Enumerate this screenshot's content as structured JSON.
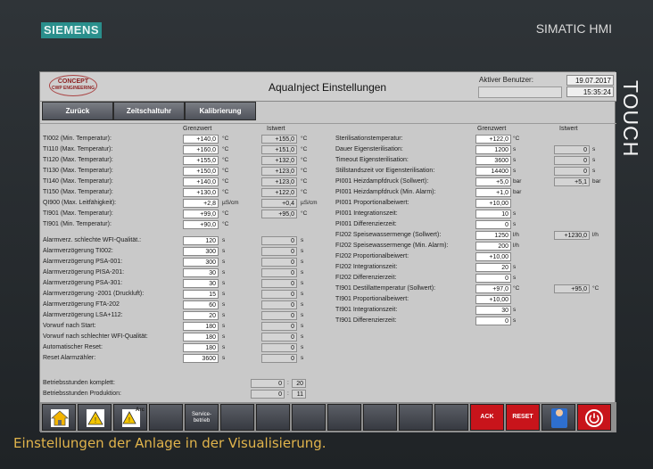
{
  "device": {
    "brand": "SIEMENS",
    "product": "SIMATIC HMI",
    "side_label": "TOUCH"
  },
  "header": {
    "logo_top": "CONCEPT",
    "logo_sub": "CWP ENGINEERING",
    "title": "AquaInject Einstellungen",
    "user_label": "Aktiver Benutzer:",
    "date": "19.07.2017",
    "time": "15:35:24"
  },
  "nav": {
    "back": "Zurück",
    "timer": "Zeitschaltuhr",
    "calibration": "Kalibrierung"
  },
  "columns": {
    "left_set": "Grenzwert",
    "left_actual": "Istwert",
    "right_set": "Grenzwert",
    "right_actual": "Istwert"
  },
  "left_limits": [
    {
      "label": "TI002 (Min. Temperatur):",
      "set": "+140,0",
      "unit": "°C",
      "actual": "+155,0",
      "aunit": "°C"
    },
    {
      "label": "TI110 (Max. Temperatur):",
      "set": "+160,0",
      "unit": "°C",
      "actual": "+151,0",
      "aunit": "°C"
    },
    {
      "label": "TI120 (Max. Temperatur):",
      "set": "+155,0",
      "unit": "°C",
      "actual": "+132,0",
      "aunit": "°C"
    },
    {
      "label": "TI130 (Max. Temperatur):",
      "set": "+150,0",
      "unit": "°C",
      "actual": "+123,0",
      "aunit": "°C"
    },
    {
      "label": "TI140 (Max. Temperatur):",
      "set": "+140,0",
      "unit": "°C",
      "actual": "+123,0",
      "aunit": "°C"
    },
    {
      "label": "TI150 (Max. Temperatur):",
      "set": "+130,0",
      "unit": "°C",
      "actual": "+122,0",
      "aunit": "°C"
    },
    {
      "label": "QI900 (Max. Leitfähigkeit):",
      "set": "+2,8",
      "unit": "µS/cm",
      "actual": "+0,4",
      "aunit": "µS/cm"
    },
    {
      "label": "TI901 (Max. Temperatur):",
      "set": "+99,0",
      "unit": "°C",
      "actual": "+95,0",
      "aunit": "°C"
    },
    {
      "label": "TI901 (Min. Temperatur):",
      "set": "+90,0",
      "unit": "°C",
      "actual": "",
      "aunit": ""
    }
  ],
  "left_delays": [
    {
      "label": "Alarmverz. schlechte WFI-Qualität.:",
      "set": "120",
      "unit": "s",
      "actual": "0",
      "aunit": "s"
    },
    {
      "label": "Alarmverzögerung TI002:",
      "set": "300",
      "unit": "s",
      "actual": "0",
      "aunit": "s"
    },
    {
      "label": "Alarmverzögerung PSA-001:",
      "set": "300",
      "unit": "s",
      "actual": "0",
      "aunit": "s"
    },
    {
      "label": "Alarmverzögerung PISA-201:",
      "set": "30",
      "unit": "s",
      "actual": "0",
      "aunit": "s"
    },
    {
      "label": "Alarmverzögerung PSA-301:",
      "set": "30",
      "unit": "s",
      "actual": "0",
      "aunit": "s"
    },
    {
      "label": "Alarmverzögerung -2001 (Druckluft):",
      "set": "15",
      "unit": "s",
      "actual": "0",
      "aunit": "s"
    },
    {
      "label": "Alarmverzögerung FTA-202",
      "set": "60",
      "unit": "s",
      "actual": "0",
      "aunit": "s"
    },
    {
      "label": "Alarmverzögerung LSA+112:",
      "set": "20",
      "unit": "s",
      "actual": "0",
      "aunit": "s"
    },
    {
      "label": "Vorwurf nach Start:",
      "set": "180",
      "unit": "s",
      "actual": "0",
      "aunit": "s"
    },
    {
      "label": "Vorwurf nach schlechter WFI-Qualität:",
      "set": "180",
      "unit": "s",
      "actual": "0",
      "aunit": "s"
    },
    {
      "label": "Automatischer Reset:",
      "set": "180",
      "unit": "s",
      "actual": "0",
      "aunit": "s"
    },
    {
      "label": "Reset Alarmzähler:",
      "set": "3600",
      "unit": "s",
      "actual": "0",
      "aunit": "s"
    }
  ],
  "hours": [
    {
      "label": "Betriebsstunden komplett:",
      "h": "0",
      "m": "20"
    },
    {
      "label": "Betriebsstunden Produktion:",
      "h": "0",
      "m": "11"
    }
  ],
  "right_rows": [
    {
      "label": "Sterilisationstemperatur:",
      "set": "+122,0",
      "unit": "°C",
      "actual": "",
      "aunit": ""
    },
    {
      "label": "Dauer Eigensterilisation:",
      "set": "1200",
      "unit": "s",
      "actual": "0",
      "aunit": "s"
    },
    {
      "label": "Timeout Eigensterilisation:",
      "set": "3600",
      "unit": "s",
      "actual": "0",
      "aunit": "s"
    },
    {
      "label": "Stillstandszeit vor Eigensterilisation:",
      "set": "14400",
      "unit": "s",
      "actual": "0",
      "aunit": "s"
    },
    {
      "label": "PI001 Heizdampfdruck (Sollwert):",
      "set": "+5,0",
      "unit": "bar",
      "actual": "+5,1",
      "aunit": "bar"
    },
    {
      "label": "PI001 Heizdampfdruck (Min. Alarm):",
      "set": "+1,0",
      "unit": "bar",
      "actual": "",
      "aunit": ""
    },
    {
      "label": "PI001 Proportionalbeiwert:",
      "set": "+10,00",
      "unit": "",
      "actual": "",
      "aunit": ""
    },
    {
      "label": "PI001 Integrationszeit:",
      "set": "10",
      "unit": "s",
      "actual": "",
      "aunit": ""
    },
    {
      "label": "PI001 Differenzierzeit:",
      "set": "0",
      "unit": "s",
      "actual": "",
      "aunit": ""
    },
    {
      "label": "FI202 Speisewassermenge (Sollwert):",
      "set": "1250",
      "unit": "l/h",
      "actual": "+1230,0",
      "aunit": "l/h"
    },
    {
      "label": "FI202 Speisewassermenge (Min. Alarm):",
      "set": "200",
      "unit": "l/h",
      "actual": "",
      "aunit": ""
    },
    {
      "label": "FI202 Proportionalbeiwert:",
      "set": "+10,00",
      "unit": "",
      "actual": "",
      "aunit": ""
    },
    {
      "label": "FI202 Integrationszeit:",
      "set": "20",
      "unit": "s",
      "actual": "",
      "aunit": ""
    },
    {
      "label": "FI202 Differenzierzeit:",
      "set": "0",
      "unit": "s",
      "actual": "",
      "aunit": ""
    },
    {
      "label": "TI901 Destillattemperatur (Sollwert):",
      "set": "+97,0",
      "unit": "°C",
      "actual": "+95,0",
      "aunit": "°C"
    },
    {
      "label": "TI901 Proportionalbeiwert:",
      "set": "+10,00",
      "unit": "",
      "actual": "",
      "aunit": ""
    },
    {
      "label": "TI901 Integrationszeit:",
      "set": "30",
      "unit": "s",
      "actual": "",
      "aunit": ""
    },
    {
      "label": "TI901 Differenzierzeit:",
      "set": "0",
      "unit": "s",
      "actual": "",
      "aunit": ""
    }
  ],
  "footer": {
    "arc": "Arc",
    "service": "Service-betrieb",
    "ack": "ACK",
    "reset": "RESET"
  },
  "caption": "Einstellungen der Anlage in der Visualisierung."
}
